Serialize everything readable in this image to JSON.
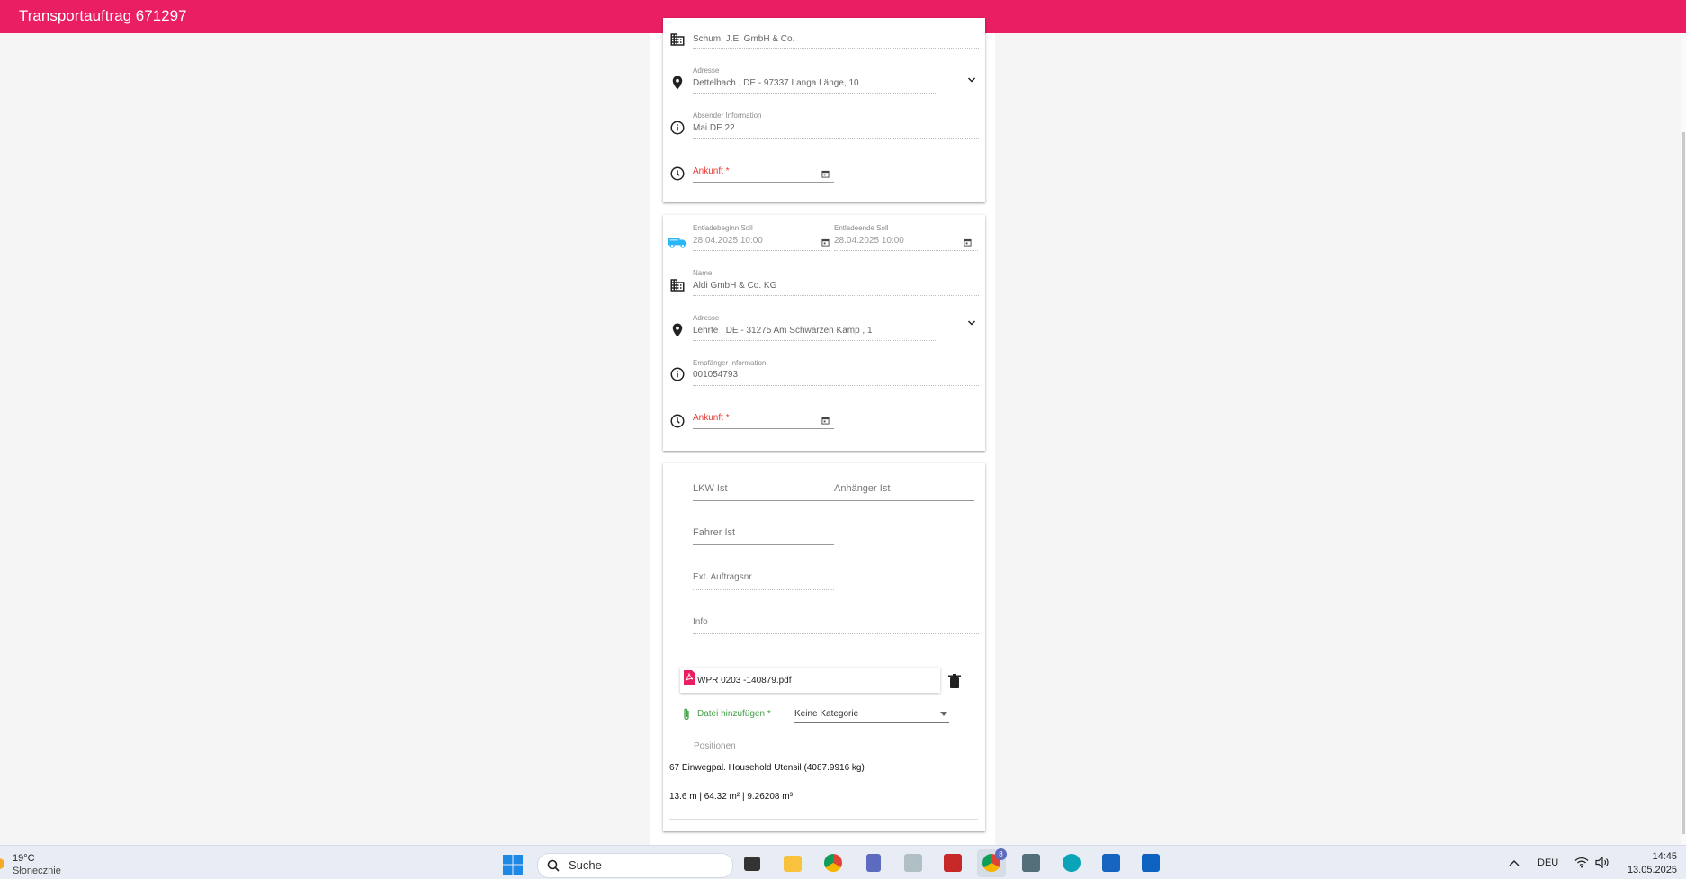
{
  "app": {
    "title": "Transportauftrag 671297"
  },
  "loading_stop": {
    "name_value": "Schum, J.E. GmbH & Co.",
    "address_label": "Adresse",
    "address_value": "Dettelbach , DE - 97337 Langa Länge, 10",
    "info_label": "Absender Information",
    "info_value": "Mai DE 22",
    "arrival_label": "Ankunft *"
  },
  "unloading_stop": {
    "start_label": "Entladebeginn Soll",
    "start_value": "28.04.2025 10:00",
    "end_label": "Entladeende Soll",
    "end_value": "28.04.2025 10:00",
    "name_label": "Name",
    "name_value": "Aldi GmbH & Co. KG",
    "address_label": "Adresse",
    "address_value": "Lehrte , DE - 31275 Am Schwarzen Kamp , 1",
    "info_label": "Empfänger Information",
    "info_value": "001054793",
    "arrival_label": "Ankunft *"
  },
  "details": {
    "truck_label": "LKW Ist",
    "trailer_label": "Anhänger Ist",
    "driver_label": "Fahrer Ist",
    "ext_order_label": "Ext. Auftragsnr.",
    "info_label": "Info",
    "attachment_name": "WPR 0203 -140879.pdf",
    "add_file_label": "Datei hinzufügen *",
    "category_value": "Keine Kategorie",
    "positions_label": "Positionen",
    "position_line": "67 Einwegpal. Household Utensil (4087.9916 kg)",
    "measure_line": "13.6 m | 64.32 m² | 9.26208 m³"
  },
  "taskbar": {
    "weather_temp": "19°C",
    "weather_desc": "Słonecznie",
    "search_placeholder": "Suche",
    "chrome_badge": "8",
    "language": "DEU",
    "time": "14:45",
    "date": "13.05.2025"
  },
  "colors": {
    "accent": "#ea1e63",
    "required": "#e53935",
    "green": "#43a047",
    "truck_icon": "#29b6f6"
  }
}
